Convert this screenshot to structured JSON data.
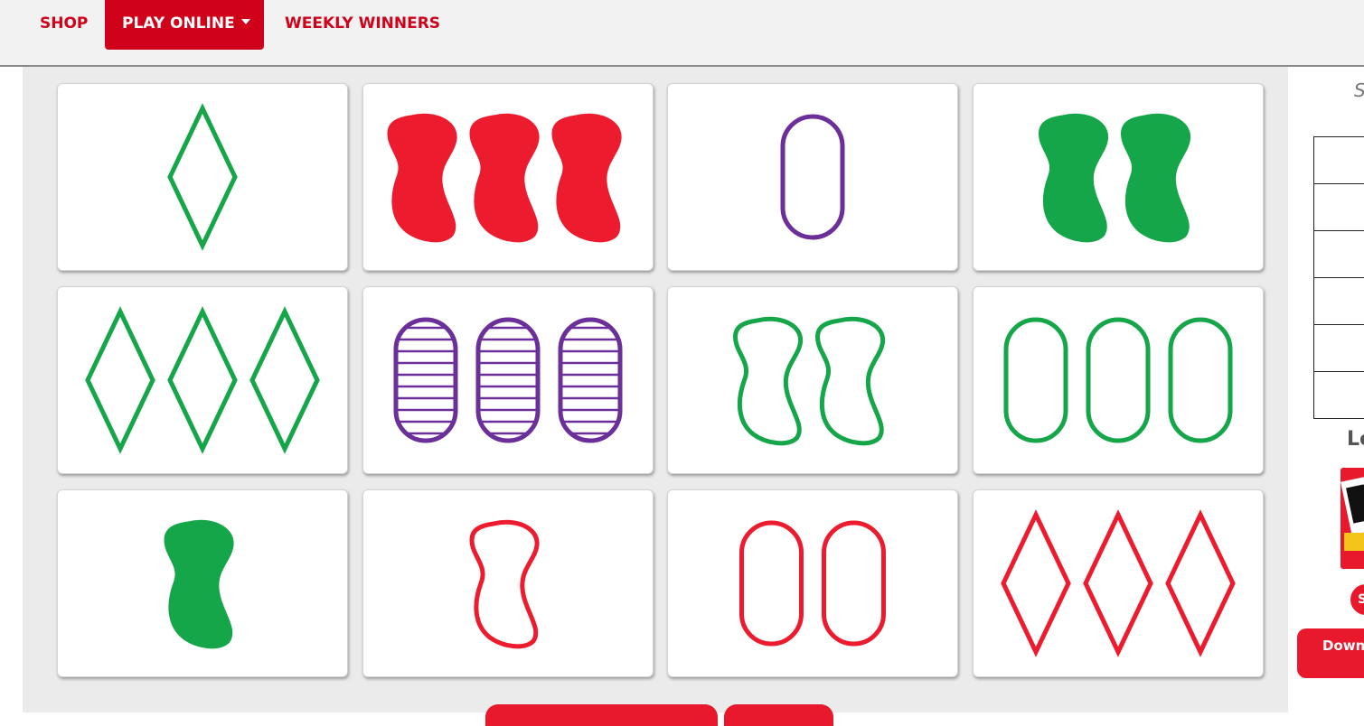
{
  "nav": {
    "shop": "SHOP",
    "play_online": "PLAY ONLINE",
    "weekly_winners": "WEEKLY WINNERS"
  },
  "colors": {
    "brand_red": "#d0021b",
    "card_red": "#ec1c2e",
    "card_green": "#15a64a",
    "card_purple": "#6b2f9a"
  },
  "cards": [
    {
      "count": 1,
      "shape": "diamond",
      "color": "green",
      "fill": "outline"
    },
    {
      "count": 3,
      "shape": "squiggle",
      "color": "red",
      "fill": "solid"
    },
    {
      "count": 1,
      "shape": "oval",
      "color": "purple",
      "fill": "outline"
    },
    {
      "count": 2,
      "shape": "squiggle",
      "color": "green",
      "fill": "solid"
    },
    {
      "count": 3,
      "shape": "diamond",
      "color": "green",
      "fill": "outline"
    },
    {
      "count": 3,
      "shape": "oval",
      "color": "purple",
      "fill": "striped"
    },
    {
      "count": 2,
      "shape": "squiggle",
      "color": "green",
      "fill": "outline"
    },
    {
      "count": 3,
      "shape": "oval",
      "color": "green",
      "fill": "outline"
    },
    {
      "count": 1,
      "shape": "squiggle",
      "color": "green",
      "fill": "solid"
    },
    {
      "count": 1,
      "shape": "squiggle",
      "color": "red",
      "fill": "outline"
    },
    {
      "count": 2,
      "shape": "oval",
      "color": "red",
      "fill": "outline"
    },
    {
      "count": 3,
      "shape": "diamond",
      "color": "red",
      "fill": "outline"
    }
  ],
  "sidebar": {
    "top_text": "S",
    "heading": "Le",
    "small_button": "S",
    "download_button": "Down"
  }
}
